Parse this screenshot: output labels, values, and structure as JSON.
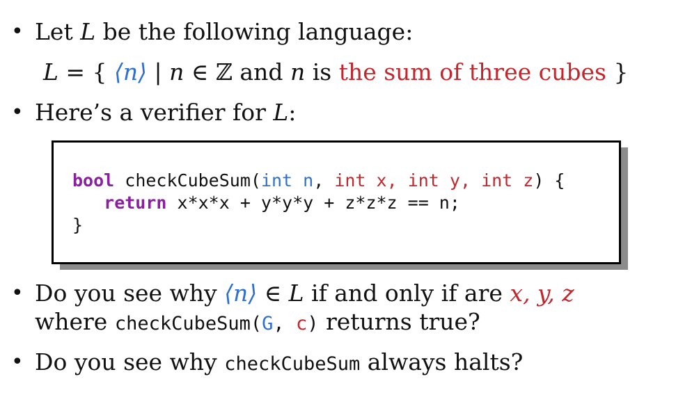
{
  "bullets": {
    "b1": {
      "prefix": "Let ",
      "var": "L",
      "suffix": " be the following language:"
    },
    "definition": {
      "lhs": "L",
      "eq": " = { ",
      "enc": "⟨n⟩",
      "bar": " | ",
      "n1": "n",
      "in_z": " ∈ ℤ and ",
      "n2": "n",
      "is": " is ",
      "highlight": "the sum of three cubes",
      "close": " }"
    },
    "b2": {
      "prefix": "Here’s a verifier for ",
      "var": "L",
      "suffix": ":"
    },
    "b3": {
      "line1_prefix": "Do you see why ",
      "enc": "⟨n⟩",
      "in": " ∈ ",
      "var": "L",
      "mid": " if and only if are ",
      "vars": "x, y, z",
      "line2_prefix": "where ",
      "fn": "checkCubeSum(",
      "arg1": "G",
      "comma": ", ",
      "arg2": "c",
      "close": ")",
      "line2_suffix": " returns true?"
    },
    "b4": {
      "prefix": "Do you see why ",
      "fn": "checkCubeSum",
      "suffix": " always halts?"
    }
  },
  "code": {
    "l1": {
      "kw_bool": "bool",
      "name": " checkCubeSum(",
      "t1": "int n",
      "sep1": ", ",
      "t2": "int x",
      "sep2": ", ",
      "t3": "int y",
      "sep3": ", ",
      "t4": "int z",
      "end": ") {"
    },
    "l2": {
      "indent": "   ",
      "kw_return": "return",
      "expr": " x*x*x + y*y*y + z*z*z == n;"
    },
    "l3": {
      "brace": "}"
    }
  },
  "colors": {
    "accent_blue": "#2f6fd0",
    "accent_red": "#c1272d",
    "keyword_purple": "#8a1fa0"
  }
}
